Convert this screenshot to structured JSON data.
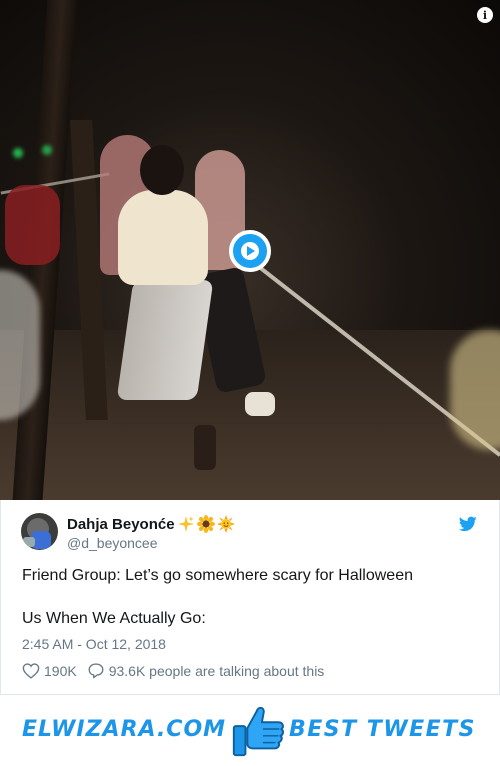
{
  "video": {
    "info_icon": "info-icon",
    "play_icon": "play-icon"
  },
  "tweet": {
    "author_name": "Dahja Beyonće",
    "author_emojis": [
      "sparkles",
      "sunflower",
      "sun-with-face"
    ],
    "handle": "@d_beyoncee",
    "text_line1": "Friend Group: Let’s go somewhere scary for Halloween",
    "text_line2": "Us When We Actually Go:",
    "timestamp": "2:45 AM - Oct 12, 2018",
    "likes": "190K",
    "talking": "93.6K people are talking about this",
    "brand_icon": "twitter-bird-icon",
    "accent_color": "#1da1f2"
  },
  "banner": {
    "left_text": "ELWIZARA.COM",
    "right_text": "BEST TWEETS",
    "center_icon": "thumbs-up-icon",
    "color": "#1d95e8"
  }
}
